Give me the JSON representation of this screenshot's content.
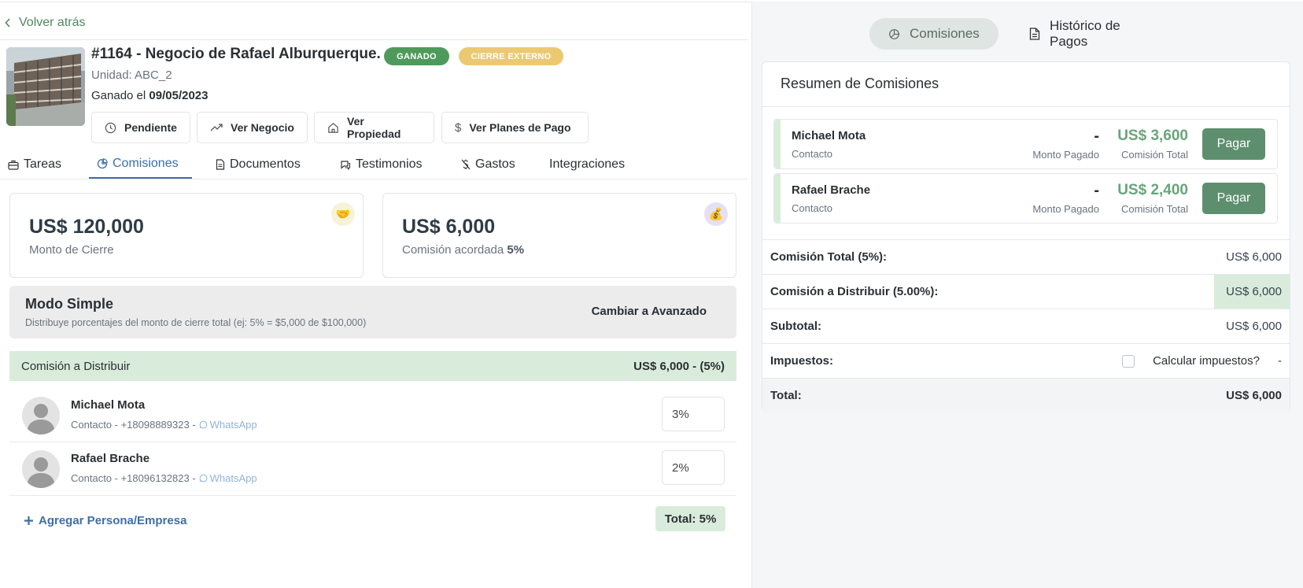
{
  "nav": {
    "back_label": "Volver atrás"
  },
  "deal": {
    "title": "#1164 - Negocio de Rafael Alburquerque.",
    "badge_won": "GANADO",
    "badge_external": "CIERRE EXTERNO",
    "unit": "Unidad: ABC_2",
    "won_prefix": "Ganado el",
    "won_date": "09/05/2023"
  },
  "actions": {
    "pending": "Pendiente",
    "view_deal": "Ver Negocio",
    "view_property": "Ver Propiedad",
    "view_plans": "Ver Planes de Pago"
  },
  "tabs": {
    "tasks": "Tareas",
    "commissions": "Comisiones",
    "documents": "Documentos",
    "testimonials": "Testimonios",
    "expenses": "Gastos",
    "integrations": "Integraciones",
    "active": "commissions"
  },
  "stats": {
    "closing_amount": "US$ 120,000",
    "closing_label": "Monto de Cierre",
    "commission_amount": "US$ 6,000",
    "commission_label": "Comisión acordada",
    "commission_pct": "5%"
  },
  "mode": {
    "title": "Modo Simple",
    "description": "Distribuye porcentajes del monto de cierre total (ej: 5% = $5,000 de $100,000)",
    "switch_label": "Cambiar a Avanzado"
  },
  "distribution": {
    "label": "Comisión a Distribuir",
    "value": "US$ 6,000 - (5%)"
  },
  "people": [
    {
      "name": "Michael Mota",
      "meta": "Contacto - +18098889323 -",
      "whatsapp": "WhatsApp",
      "percent": "3%"
    },
    {
      "name": "Rafael Brache",
      "meta": "Contacto - +18096132823 -",
      "whatsapp": "WhatsApp",
      "percent": "2%"
    }
  ],
  "add_person": "Agregar Persona/Empresa",
  "total_pill": "Total: 5%",
  "right": {
    "tab_commissions": "Comisiones",
    "tab_history": "Histórico de Pagos",
    "summary_title": "Resumen de Comisiones",
    "payees": [
      {
        "name": "Michael Mota",
        "type": "Contacto",
        "paid": "-",
        "paid_label": "Monto Pagado",
        "total": "US$ 3,600",
        "total_label": "Comisión Total",
        "pay_label": "Pagar"
      },
      {
        "name": "Rafael Brache",
        "type": "Contacto",
        "paid": "-",
        "paid_label": "Monto Pagado",
        "total": "US$ 2,400",
        "total_label": "Comisión Total",
        "pay_label": "Pagar"
      }
    ],
    "rows": {
      "total_commission_label": "Comisión Total (5%):",
      "total_commission_value": "US$ 6,000",
      "to_distribute_label": "Comisión a Distribuir (5.00%):",
      "to_distribute_value": "US$ 6,000",
      "subtotal_label": "Subtotal:",
      "subtotal_value": "US$ 6,000",
      "taxes_label": "Impuestos:",
      "taxes_checkbox_label": "Calcular impuestos?",
      "taxes_value": "-",
      "total_label": "Total:",
      "total_value": "US$ 6,000"
    }
  },
  "colors": {
    "accent_green": "#4d8a5e",
    "link_blue": "#3e6fa7",
    "highlight_green": "#d9ecdc",
    "pay_button": "#5d8f6e",
    "badge_won": "#4e9a5b",
    "badge_external": "#ecc971"
  }
}
